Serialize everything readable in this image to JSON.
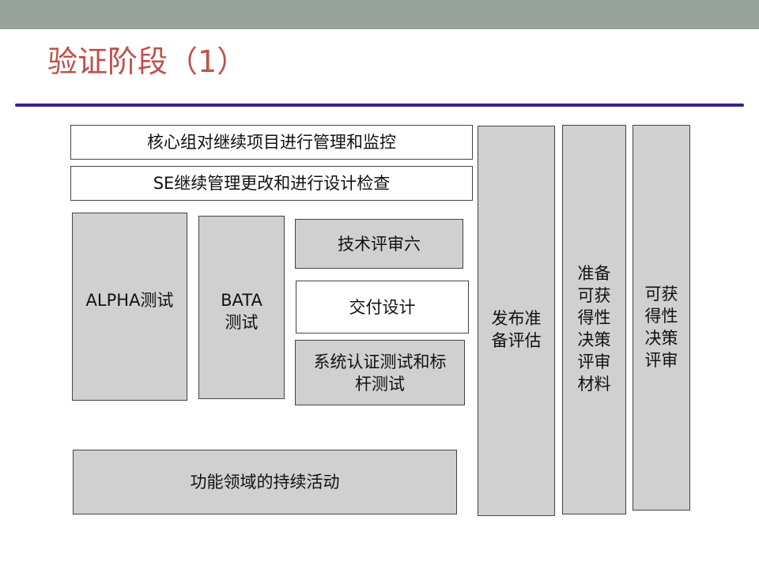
{
  "title": "验证阶段（1）",
  "colors": {
    "top_band": "#96a29a",
    "title_text": "#c0504d",
    "rule": "#3c1f8c",
    "box_gray": "#d0d0d0",
    "box_border": "#444444"
  },
  "boxes": {
    "core_group": "核心组对继续项目进行管理和监控",
    "se_management": "SE继续管理更改和进行设计检查",
    "alpha_test": "ALPHA测试",
    "bata_test": "BATA测试",
    "tech_review": "技术评审六",
    "deliver_design": "交付设计",
    "system_cert": "系统认证测试和标杆测试",
    "functional_activities": "功能领域的持续活动",
    "release_eval": "发布准备评估",
    "prepare_materials": "准备可获得性决策评审材料",
    "availability_review": "可获得性决策评审"
  }
}
